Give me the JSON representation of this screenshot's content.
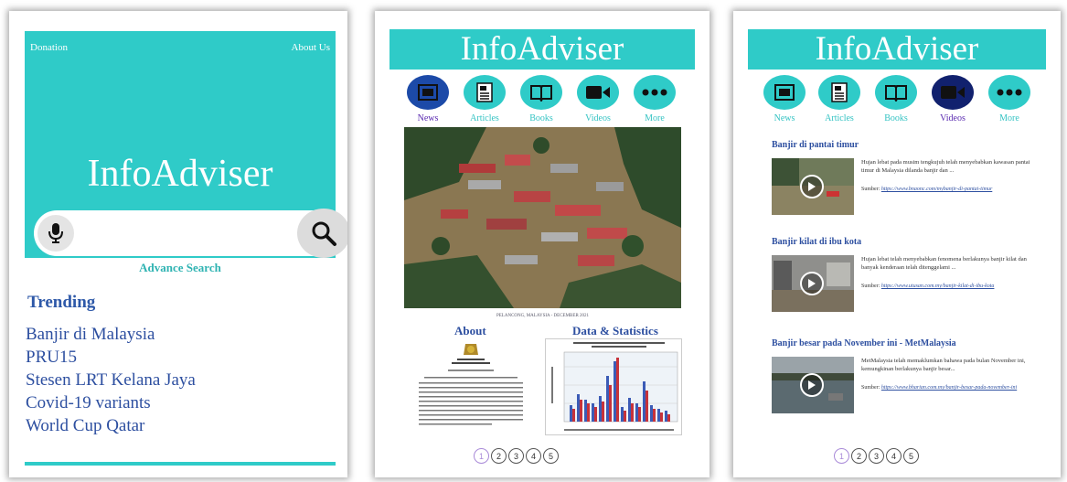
{
  "home": {
    "top_left_link": "Donation",
    "top_right_link": "About Us",
    "title": "InfoAdviser",
    "search_placeholder": "",
    "advance_search": "Advance Search",
    "trending_title": "Trending",
    "trending_items": [
      "Banjir di Malaysia",
      "PRU15",
      "Stesen LRT Kelana Jaya",
      "Covid-19 variants",
      "World Cup Qatar"
    ]
  },
  "news": {
    "title": "InfoAdviser",
    "nav": [
      {
        "label": "News",
        "icon": "news-icon"
      },
      {
        "label": "Articles",
        "icon": "article-icon"
      },
      {
        "label": "Books",
        "icon": "book-icon"
      },
      {
        "label": "Videos",
        "icon": "video-camera-icon"
      },
      {
        "label": "More",
        "icon": "more-icon"
      }
    ],
    "active_nav": "News",
    "photo_caption": "PELANCONG, MALAYSIA - DECEMBER 2021",
    "about_title": "About",
    "stats_title": "Data & Statistics",
    "pages": [
      "1",
      "2",
      "3",
      "4",
      "5"
    ],
    "current_page": "1"
  },
  "videos": {
    "title": "InfoAdviser",
    "nav": [
      {
        "label": "News",
        "icon": "news-icon"
      },
      {
        "label": "Articles",
        "icon": "article-icon"
      },
      {
        "label": "Books",
        "icon": "book-icon"
      },
      {
        "label": "Videos",
        "icon": "video-camera-icon"
      },
      {
        "label": "More",
        "icon": "more-icon"
      }
    ],
    "active_nav": "Videos",
    "items": [
      {
        "title": "Banjir di pantai timur",
        "desc": "Hujan lebat pada musim tengkujuh telah menyebabkan kawasan pantai timur di Malaysia dilanda banjir dan ...",
        "source_label": "Sumber:",
        "source_link": "https://www.bnaonc.com/mybanjir-di-pantai-timur"
      },
      {
        "title": "Banjir kilat di ibu kota",
        "desc": "Hujan lebat telah menyebabkan fenomena berlakunya banjir kilat dan banyak kenderaan telah ditenggelami ...",
        "source_label": "Sumber:",
        "source_link": "https://www.utusan.com.my/banjir-kilat-di-ibu-kota"
      },
      {
        "title": "Banjir besar pada November ini - MetMalaysia",
        "desc": "MetMalaysia telah memaklumkan bahawa pada bulan November ini, kemungkinan berlakunya banjir besar...",
        "source_label": "Sumber:",
        "source_link": "https://www.bharian.com.my/banjir-besar-pada-november-ini"
      }
    ],
    "pages": [
      "1",
      "2",
      "3",
      "4",
      "5"
    ],
    "current_page": "1"
  }
}
